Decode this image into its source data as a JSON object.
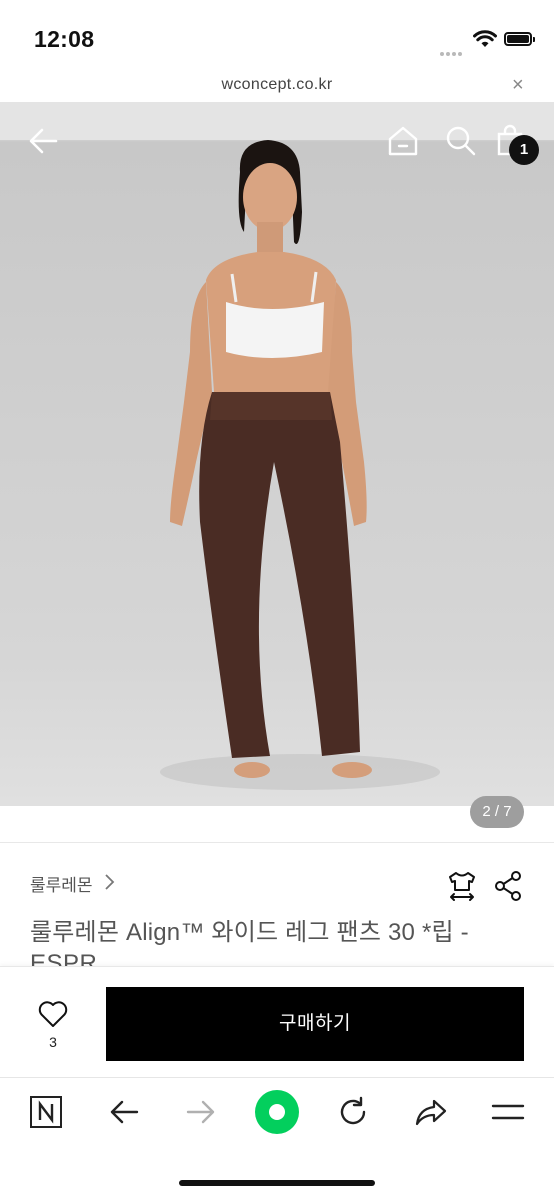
{
  "status_bar": {
    "time": "12:08"
  },
  "browser": {
    "url": "wconcept.co.kr",
    "close_glyph": "×"
  },
  "product_nav": {
    "cart_count": "1",
    "icons": [
      "back-arrow-icon",
      "home-icon",
      "search-icon",
      "shopping-bag-icon"
    ]
  },
  "gallery": {
    "page": "2 / 7"
  },
  "product": {
    "brand": "룰루레몬",
    "title": "룰루레몬 Align™ 와이드 레그 팬츠 30 *립 -",
    "title_cont": "ESPR",
    "icons": [
      "size-guide-icon",
      "share-icon"
    ]
  },
  "purchase": {
    "like_count": "3",
    "buy_label": "구매하기"
  },
  "toolbar": {
    "icons": [
      "naver-n-icon",
      "back-icon",
      "forward-icon",
      "green-dot-icon",
      "refresh-icon",
      "share-arrow-icon",
      "menu-icon"
    ]
  },
  "colors": {
    "accent_green": "#03cf5d",
    "primary": "#000000"
  }
}
